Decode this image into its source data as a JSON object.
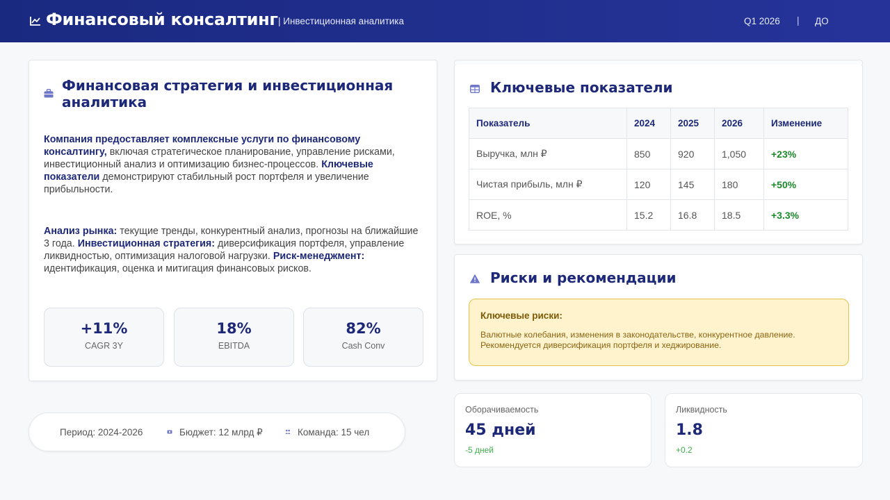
{
  "header": {
    "title": "Финансовый консалтинг",
    "subtitle": "| Инвестиционная аналитика",
    "period": "Q1 2026",
    "separator": "|",
    "user": "ДО"
  },
  "strategy": {
    "title": "Финансовая стратегия и инвестиционная аналитика",
    "p1_b1": "Компания предоставляет комплексные услуги по финансовому консалтингу,",
    "p1_t1": " включая стратегическое планирование, управление рисками, инвестиционный анализ и оптимизацию бизнес-процессов. ",
    "p1_b2": "Ключевые показатели",
    "p1_t2": " демонстрируют стабильный рост портфеля и увеличение прибыльности.",
    "p2_b1": "Анализ рынка:",
    "p2_t1": " текущие тренды, конкурентный анализ, прогнозы на ближайшие 3 года. ",
    "p2_b2": "Инвестиционная стратегия:",
    "p2_t2": " диверсификация портфеля, управление ликвидностью, оптимизация налоговой нагрузки. ",
    "p2_b3": "Риск-менеджмент:",
    "p2_t3": " идентификация, оценка и митигация финансовых рисков.",
    "kpis": [
      {
        "value": "+11%",
        "label": "CAGR 3Y"
      },
      {
        "value": "18%",
        "label": "EBITDA"
      },
      {
        "value": "82%",
        "label": "Cash Conv"
      }
    ]
  },
  "metrics": {
    "title": "Ключевые показатели",
    "headers": [
      "Показатель",
      "2024",
      "2025",
      "2026",
      "Изменение"
    ],
    "rows": [
      [
        "Выручка, млн ₽",
        "850",
        "920",
        "1,050",
        "+23%"
      ],
      [
        "Чистая прибыль, млн ₽",
        "120",
        "145",
        "180",
        "+50%"
      ],
      [
        "ROE, %",
        "15.2",
        "16.8",
        "18.5",
        "+3.3%"
      ]
    ]
  },
  "risks": {
    "title": "Риски и рекомендации",
    "alert_title": "Ключевые риски:",
    "alert_text": "Валютные колебания, изменения в законодательстве, конкурентное давление. Рекомендуется диверсификация портфеля и хеджирование."
  },
  "footer": {
    "period": "Период: 2024-2026",
    "budget": "Бюджет: 12 млрд ₽",
    "team": "Команда: 15 чел"
  },
  "stats": [
    {
      "label": "Оборачиваемость",
      "value": "45 дней",
      "delta": "-5 дней"
    },
    {
      "label": "Ликвидность",
      "value": "1.8",
      "delta": "+0.2"
    }
  ],
  "colors": {
    "primary": "#1d2878",
    "header_bg": "#1a2980",
    "positive": "#1c8a2a",
    "alert_bg": "#fff3cd",
    "alert_border": "#e4c54a"
  }
}
